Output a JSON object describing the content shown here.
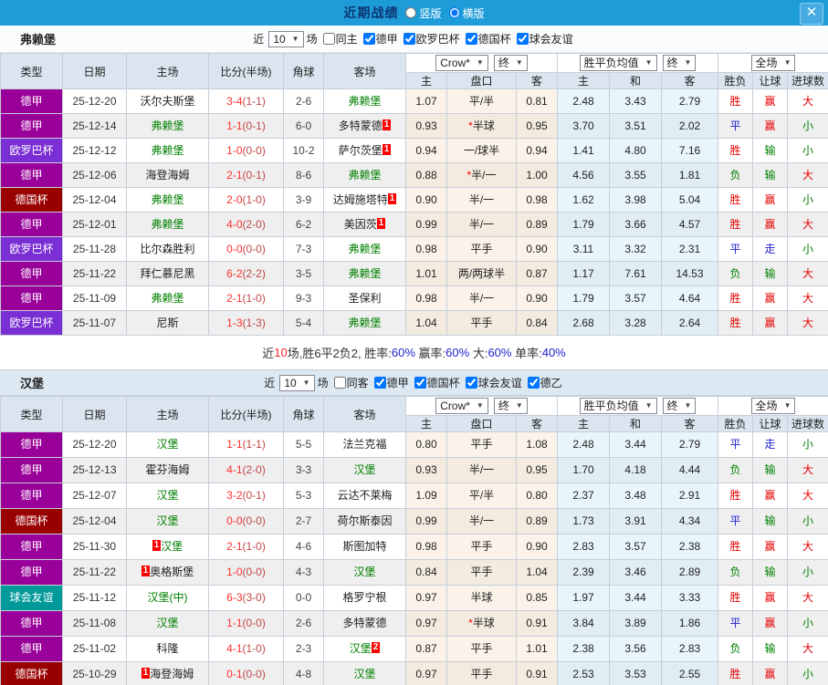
{
  "titlebar": {
    "title": "近期战绩",
    "radios": [
      {
        "label": "竖版",
        "checked": false
      },
      {
        "label": "横版",
        "checked": true
      }
    ],
    "close_icon": "✕"
  },
  "table_header": {
    "left": [
      "类型",
      "日期",
      "主场",
      "比分(半场)",
      "角球",
      "客场"
    ],
    "group1": {
      "select1": "Crow*",
      "select2": "终",
      "cols": [
        "主",
        "盘口",
        "客"
      ]
    },
    "group2": {
      "select1": "胜平负均值",
      "select2": "终",
      "cols": [
        "主",
        "和",
        "客"
      ]
    },
    "group3": {
      "select1": "全场",
      "cols": [
        "胜负",
        "让球",
        "进球数"
      ]
    }
  },
  "type_colors": {
    "德甲": "#990099",
    "欧罗巴杯": "#7a2fd4",
    "德国杯": "#990000",
    "球会友谊": "#009999",
    "德乙": "#009999"
  },
  "result_colors": {
    "胜": "#e60000",
    "赢": "#e60000",
    "大": "#e60000",
    "平": "#2121cc",
    "走": "#2121cc",
    "负": "#008000",
    "输": "#008000",
    "小": "#008000"
  },
  "sections": [
    {
      "team": "弗赖堡",
      "filter": {
        "near_label": "近",
        "count": "10",
        "games_label": "场",
        "same": {
          "label": "同主",
          "checked": false
        },
        "leagues": [
          {
            "label": "德甲",
            "checked": true
          },
          {
            "label": "欧罗巴杯",
            "checked": true
          },
          {
            "label": "德国杯",
            "checked": true
          },
          {
            "label": "球会友谊",
            "checked": true
          }
        ]
      },
      "rows": [
        {
          "type": "德甲",
          "date": "25-12-20",
          "home": "沃尔夫斯堡",
          "score_ft": "3-4",
          "score_ht": "1-1",
          "corner": "2-6",
          "away": "弗赖堡",
          "away_self": true,
          "odds1": [
            "1.07",
            "平/半",
            "0.81"
          ],
          "odds2": [
            "2.48",
            "3.43",
            "2.79"
          ],
          "results": [
            "胜",
            "赢",
            "大"
          ]
        },
        {
          "type": "德甲",
          "date": "25-12-14",
          "home": "弗赖堡",
          "home_self": true,
          "score_ft": "1-1",
          "score_ht": "0-1",
          "corner": "6-0",
          "away": "多特蒙德",
          "away_badge": "1",
          "away_badge_pos": "after",
          "odds1": [
            "0.93",
            "*半球",
            "0.95"
          ],
          "odds2": [
            "3.70",
            "3.51",
            "2.02"
          ],
          "results": [
            "平",
            "赢",
            "小"
          ]
        },
        {
          "type": "欧罗巴杯",
          "date": "25-12-12",
          "home": "弗赖堡",
          "home_self": true,
          "score_ft": "1-0",
          "score_ht": "0-0",
          "corner": "10-2",
          "away": "萨尔茨堡",
          "away_badge": "1",
          "away_badge_pos": "after",
          "odds1": [
            "0.94",
            "一/球半",
            "0.94"
          ],
          "odds2": [
            "1.41",
            "4.80",
            "7.16"
          ],
          "results": [
            "胜",
            "输",
            "小"
          ]
        },
        {
          "type": "德甲",
          "date": "25-12-06",
          "home": "海登海姆",
          "score_ft": "2-1",
          "score_ht": "0-1",
          "corner": "8-6",
          "away": "弗赖堡",
          "away_self": true,
          "odds1": [
            "0.88",
            "*半/一",
            "1.00"
          ],
          "odds2": [
            "4.56",
            "3.55",
            "1.81"
          ],
          "results": [
            "负",
            "输",
            "大"
          ]
        },
        {
          "type": "德国杯",
          "date": "25-12-04",
          "home": "弗赖堡",
          "home_self": true,
          "score_ft": "2-0",
          "score_ht": "1-0",
          "corner": "3-9",
          "away": "达姆施塔特",
          "away_badge": "1",
          "away_badge_pos": "after",
          "odds1": [
            "0.90",
            "半/一",
            "0.98"
          ],
          "odds2": [
            "1.62",
            "3.98",
            "5.04"
          ],
          "results": [
            "胜",
            "赢",
            "小"
          ]
        },
        {
          "type": "德甲",
          "date": "25-12-01",
          "home": "弗赖堡",
          "home_self": true,
          "score_ft": "4-0",
          "score_ht": "2-0",
          "corner": "6-2",
          "away": "美因茨",
          "away_badge": "1",
          "away_badge_pos": "after",
          "odds1": [
            "0.99",
            "半/一",
            "0.89"
          ],
          "odds2": [
            "1.79",
            "3.66",
            "4.57"
          ],
          "results": [
            "胜",
            "赢",
            "大"
          ]
        },
        {
          "type": "欧罗巴杯",
          "date": "25-11-28",
          "home": "比尔森胜利",
          "score_ft": "0-0",
          "score_ht": "0-0",
          "corner": "7-3",
          "away": "弗赖堡",
          "away_self": true,
          "odds1": [
            "0.98",
            "平手",
            "0.90"
          ],
          "odds2": [
            "3.11",
            "3.32",
            "2.31"
          ],
          "results": [
            "平",
            "走",
            "小"
          ]
        },
        {
          "type": "德甲",
          "date": "25-11-22",
          "home": "拜仁慕尼黑",
          "score_ft": "6-2",
          "score_ht": "2-2",
          "corner": "3-5",
          "away": "弗赖堡",
          "away_self": true,
          "odds1": [
            "1.01",
            "两/两球半",
            "0.87"
          ],
          "odds2": [
            "1.17",
            "7.61",
            "14.53"
          ],
          "results": [
            "负",
            "输",
            "大"
          ]
        },
        {
          "type": "德甲",
          "date": "25-11-09",
          "home": "弗赖堡",
          "home_self": true,
          "score_ft": "2-1",
          "score_ht": "1-0",
          "corner": "9-3",
          "away": "圣保利",
          "odds1": [
            "0.98",
            "半/一",
            "0.90"
          ],
          "odds2": [
            "1.79",
            "3.57",
            "4.64"
          ],
          "results": [
            "胜",
            "赢",
            "大"
          ]
        },
        {
          "type": "欧罗巴杯",
          "date": "25-11-07",
          "home": "尼斯",
          "score_ft": "1-3",
          "score_ht": "1-3",
          "corner": "5-4",
          "away": "弗赖堡",
          "away_self": true,
          "odds1": [
            "1.04",
            "平手",
            "0.84"
          ],
          "odds2": [
            "2.68",
            "3.28",
            "2.64"
          ],
          "results": [
            "胜",
            "赢",
            "大"
          ]
        }
      ],
      "summary": [
        {
          "text": "近",
          "color": "#333333"
        },
        {
          "text": "10",
          "color": "#ee2222"
        },
        {
          "text": "场,胜6平2负2, 胜率:",
          "color": "#333333"
        },
        {
          "text": "60%",
          "color": "#2121cc"
        },
        {
          "text": " 赢率:",
          "color": "#333333"
        },
        {
          "text": "60%",
          "color": "#2121cc"
        },
        {
          "text": " 大:",
          "color": "#333333"
        },
        {
          "text": "60%",
          "color": "#2121cc"
        },
        {
          "text": " 单率:",
          "color": "#333333"
        },
        {
          "text": "40%",
          "color": "#2121cc"
        }
      ]
    },
    {
      "team": "汉堡",
      "filter": {
        "near_label": "近",
        "count": "10",
        "games_label": "场",
        "same": {
          "label": "同客",
          "checked": false
        },
        "leagues": [
          {
            "label": "德甲",
            "checked": true
          },
          {
            "label": "德国杯",
            "checked": true
          },
          {
            "label": "球会友谊",
            "checked": true
          },
          {
            "label": "德乙",
            "checked": true
          }
        ]
      },
      "rows": [
        {
          "type": "德甲",
          "date": "25-12-20",
          "home": "汉堡",
          "home_self": true,
          "score_ft": "1-1",
          "score_ht": "1-1",
          "corner": "5-5",
          "away": "法兰克福",
          "odds1": [
            "0.80",
            "平手",
            "1.08"
          ],
          "odds2": [
            "2.48",
            "3.44",
            "2.79"
          ],
          "results": [
            "平",
            "走",
            "小"
          ]
        },
        {
          "type": "德甲",
          "date": "25-12-13",
          "home": "霍芬海姆",
          "score_ft": "4-1",
          "score_ht": "2-0",
          "corner": "3-3",
          "away": "汉堡",
          "away_self": true,
          "odds1": [
            "0.93",
            "半/一",
            "0.95"
          ],
          "odds2": [
            "1.70",
            "4.18",
            "4.44"
          ],
          "results": [
            "负",
            "输",
            "大"
          ]
        },
        {
          "type": "德甲",
          "date": "25-12-07",
          "home": "汉堡",
          "home_self": true,
          "score_ft": "3-2",
          "score_ht": "0-1",
          "corner": "5-3",
          "away": "云达不莱梅",
          "odds1": [
            "1.09",
            "平/半",
            "0.80"
          ],
          "odds2": [
            "2.37",
            "3.48",
            "2.91"
          ],
          "results": [
            "胜",
            "赢",
            "大"
          ]
        },
        {
          "type": "德国杯",
          "date": "25-12-04",
          "home": "汉堡",
          "home_self": true,
          "score_ft": "0-0",
          "score_ht": "0-0",
          "corner": "2-7",
          "away": "荷尔斯泰因",
          "odds1": [
            "0.99",
            "半/一",
            "0.89"
          ],
          "odds2": [
            "1.73",
            "3.91",
            "4.34"
          ],
          "results": [
            "平",
            "输",
            "小"
          ]
        },
        {
          "type": "德甲",
          "date": "25-11-30",
          "home": "汉堡",
          "home_self": true,
          "home_badge": "1",
          "home_badge_pos": "before",
          "score_ft": "2-1",
          "score_ht": "1-0",
          "corner": "4-6",
          "away": "斯图加特",
          "odds1": [
            "0.98",
            "平手",
            "0.90"
          ],
          "odds2": [
            "2.83",
            "3.57",
            "2.38"
          ],
          "results": [
            "胜",
            "赢",
            "大"
          ]
        },
        {
          "type": "德甲",
          "date": "25-11-22",
          "home": "奥格斯堡",
          "home_badge": "1",
          "home_badge_pos": "before",
          "score_ft": "1-0",
          "score_ht": "0-0",
          "corner": "4-3",
          "away": "汉堡",
          "away_self": true,
          "odds1": [
            "0.84",
            "平手",
            "1.04"
          ],
          "odds2": [
            "2.39",
            "3.46",
            "2.89"
          ],
          "results": [
            "负",
            "输",
            "小"
          ]
        },
        {
          "type": "球会友谊",
          "date": "25-11-12",
          "home": "汉堡(中)",
          "home_self": true,
          "score_ft": "6-3",
          "score_ht": "3-0",
          "corner": "0-0",
          "away": "格罗宁根",
          "odds1": [
            "0.97",
            "半球",
            "0.85"
          ],
          "odds2": [
            "1.97",
            "3.44",
            "3.33"
          ],
          "results": [
            "胜",
            "赢",
            "大"
          ]
        },
        {
          "type": "德甲",
          "date": "25-11-08",
          "home": "汉堡",
          "home_self": true,
          "score_ft": "1-1",
          "score_ht": "0-0",
          "corner": "2-6",
          "away": "多特蒙德",
          "odds1": [
            "0.97",
            "*半球",
            "0.91"
          ],
          "odds2": [
            "3.84",
            "3.89",
            "1.86"
          ],
          "results": [
            "平",
            "赢",
            "小"
          ]
        },
        {
          "type": "德甲",
          "date": "25-11-02",
          "home": "科隆",
          "score_ft": "4-1",
          "score_ht": "1-0",
          "corner": "2-3",
          "away": "汉堡",
          "away_self": true,
          "away_badge": "2",
          "away_badge_pos": "after",
          "odds1": [
            "0.87",
            "平手",
            "1.01"
          ],
          "odds2": [
            "2.38",
            "3.56",
            "2.83"
          ],
          "results": [
            "负",
            "输",
            "大"
          ]
        },
        {
          "type": "德国杯",
          "date": "25-10-29",
          "home": "海登海姆",
          "home_badge": "1",
          "home_badge_pos": "before",
          "score_ft": "0-1",
          "score_ht": "0-0",
          "corner": "4-8",
          "away": "汉堡",
          "away_self": true,
          "odds1": [
            "0.97",
            "平手",
            "0.91"
          ],
          "odds2": [
            "2.53",
            "3.53",
            "2.55"
          ],
          "results": [
            "胜",
            "赢",
            "小"
          ]
        }
      ]
    }
  ]
}
